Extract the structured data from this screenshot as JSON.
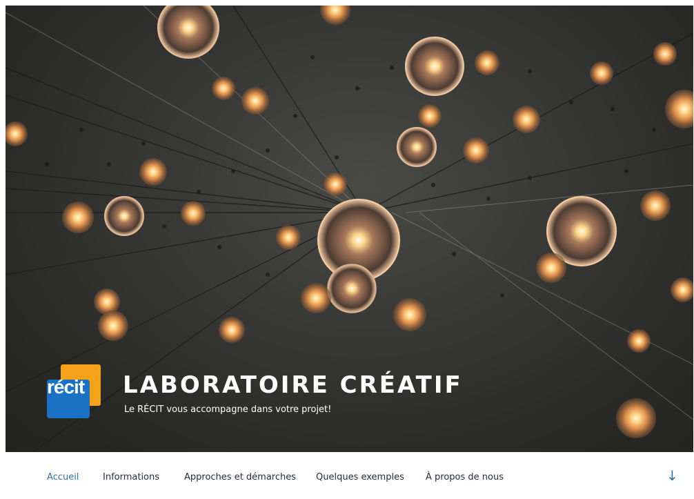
{
  "brand": {
    "logo_text": "récit",
    "title": "LABORATOIRE CRÉATIF",
    "subtitle": "Le RÉCIT vous accompagne dans votre projet!"
  },
  "nav": {
    "items": [
      {
        "label": "Accueil",
        "active": true
      },
      {
        "label": "Informations",
        "active": false
      },
      {
        "label": "Approches et démarches",
        "active": false
      },
      {
        "label": "Quelques exemples",
        "active": false
      },
      {
        "label": "À propos de nous",
        "active": false
      }
    ],
    "scroll_icon": "arrow-down-icon"
  },
  "colors": {
    "accent": "#2f6fb3",
    "logo_orange": "#f3a21a",
    "logo_blue": "#1a72c4",
    "hero_bg": "#2e2f2d"
  }
}
